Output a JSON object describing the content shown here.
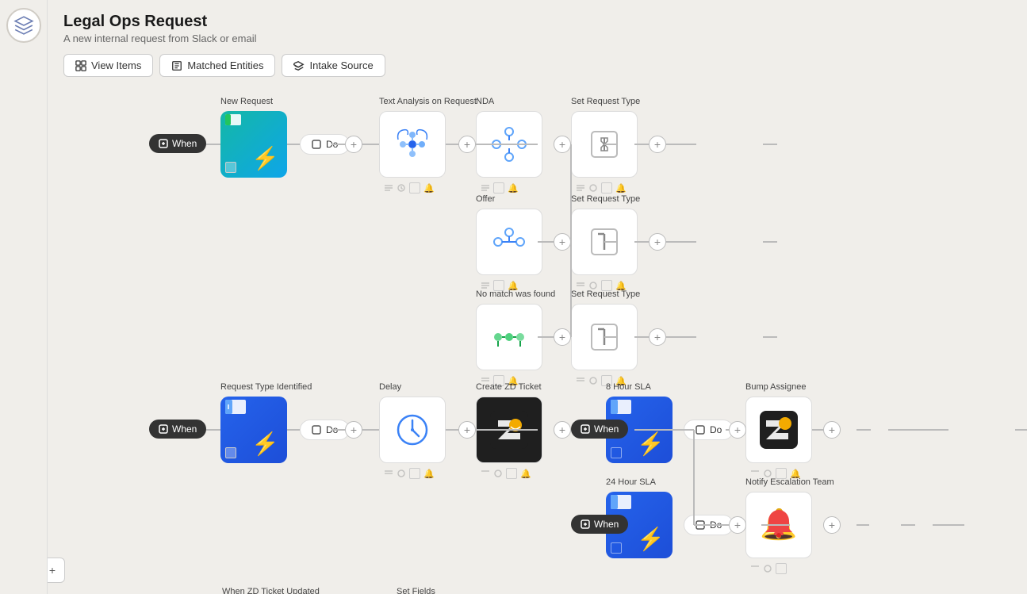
{
  "app": {
    "title": "Legal Ops Request",
    "subtitle": "A new internal request from Slack or email"
  },
  "header": {
    "buttons": [
      {
        "id": "view-items",
        "label": "View Items",
        "icon": "grid"
      },
      {
        "id": "matched-entities",
        "label": "Matched Entities",
        "icon": "copy"
      },
      {
        "id": "intake-source",
        "label": "Intake Source",
        "icon": "tag"
      }
    ]
  },
  "triggers": [
    {
      "id": "when1",
      "label": "When"
    },
    {
      "id": "when2",
      "label": "When"
    },
    {
      "id": "when3",
      "label": "When"
    },
    {
      "id": "when4",
      "label": "When"
    }
  ],
  "do_pills": [
    {
      "id": "do1",
      "label": "Do"
    },
    {
      "id": "do2",
      "label": "Do"
    },
    {
      "id": "do3",
      "label": "Do"
    },
    {
      "id": "do4",
      "label": "Do"
    }
  ],
  "nodes": [
    {
      "id": "new-request",
      "label": "New Request",
      "type": "lightning-teal"
    },
    {
      "id": "text-analysis",
      "label": "Text Analysis on Request",
      "type": "brain"
    },
    {
      "id": "nda",
      "label": "NDA",
      "type": "network"
    },
    {
      "id": "offer",
      "label": "Offer",
      "type": "network-small"
    },
    {
      "id": "no-match",
      "label": "No match was found",
      "type": "network-dots"
    },
    {
      "id": "set-request-type-1",
      "label": "Set Request Type",
      "type": "cursor"
    },
    {
      "id": "set-request-type-2",
      "label": "Set Request Type",
      "type": "cursor"
    },
    {
      "id": "set-request-type-3",
      "label": "Set Request Type",
      "type": "cursor"
    },
    {
      "id": "request-type-identified",
      "label": "Request Type Identified",
      "type": "lightning-blue"
    },
    {
      "id": "delay",
      "label": "Delay",
      "type": "clock"
    },
    {
      "id": "create-zd-ticket",
      "label": "Create ZD Ticket",
      "type": "zendesk"
    },
    {
      "id": "8hr-sla",
      "label": "8 Hour SLA",
      "type": "lightning-blue"
    },
    {
      "id": "24hr-sla",
      "label": "24 Hour SLA",
      "type": "lightning-blue"
    },
    {
      "id": "bump-assignee",
      "label": "Bump Assignee",
      "type": "zendesk"
    },
    {
      "id": "notify-escalation",
      "label": "Notify Escalation Team",
      "type": "bell-red"
    }
  ],
  "zoom": {
    "in_label": "+",
    "out_label": "−"
  }
}
